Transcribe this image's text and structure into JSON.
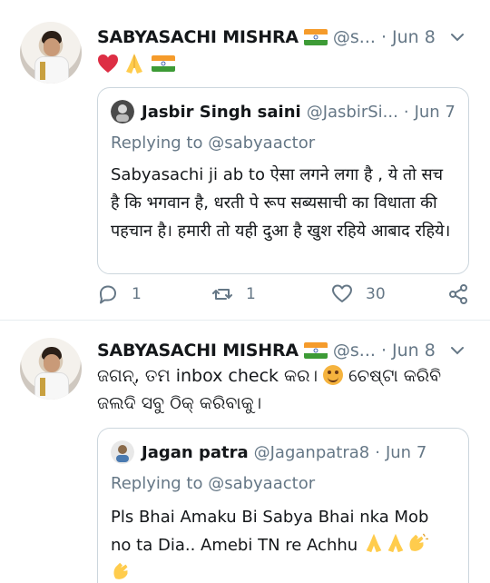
{
  "tweets": [
    {
      "name": "SABYASACHI MISHRA",
      "handle": "@s...",
      "time": "Jun 8",
      "emojis": [
        "heart",
        "folded-hands",
        "india-flag"
      ],
      "quote": {
        "name": "Jasbir Singh saini",
        "handle": "@JasbirSi...",
        "time": "Jun 7",
        "reply": "Replying to @sabyaactor",
        "text": "Sabyasachi ji ab to ऐसा लगने लगा है , ये तो सच है कि भगवान है, धरती पे रूप सब्यसाची का विधाता की पहचान है। हमारी तो यही दुआ है खुश रहिये आबाद रहिये।"
      },
      "actions": {
        "replies": "1",
        "retweets": "1",
        "likes": "30"
      }
    },
    {
      "name": "SABYASACHI MISHRA",
      "handle": "@s...",
      "time": "Jun 8",
      "text_part1": "ଜଗନ୍, ତମ inbox check କର। ",
      "text_part2": " ଚେଷ୍ଟା କରିବି ଜଲଦି ସବୁ ଠିକ୍ କରିବାକୁ।",
      "quote": {
        "name": "Jagan patra",
        "handle": "@Jaganpatra8",
        "time": "Jun 7",
        "reply": "Replying to @sabyaactor",
        "text": "Pls Bhai Amaku Bi Sabya Bhai nka Mob no ta Dia.. Amebi TN re Achhu"
      }
    }
  ],
  "colors": {
    "text": "#14171a",
    "secondary": "#657786",
    "border": "#ccd6dd",
    "divider": "#e6ecf0"
  }
}
